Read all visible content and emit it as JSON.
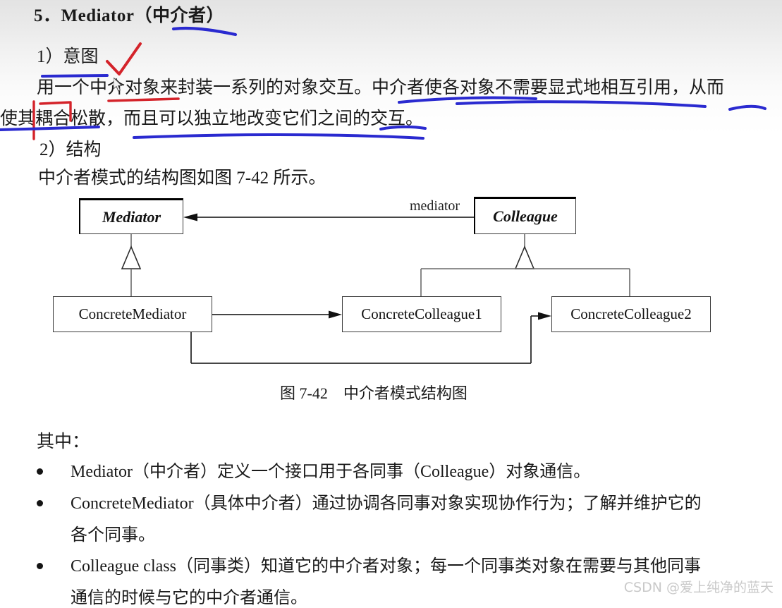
{
  "document": {
    "heading": "5．Mediator（中介者）",
    "section_intent_label": "1）意图",
    "intent_line1": "用一个中介对象来封装一系列的对象交互。中介者使各对象不需要显式地相互引用，从而",
    "intent_line2": "使其耦合松散，而且可以独立地改变它们之间的交互。",
    "section_structure_label": "2）结构",
    "structure_line": "中介者模式的结构图如图 7-42 所示。",
    "figure_caption": "图 7-42　中介者模式结构图",
    "where_label": "其中：",
    "bullets": [
      {
        "line1": "Mediator（中介者）定义一个接口用于各同事（Colleague）对象通信。",
        "line2": ""
      },
      {
        "line1": "ConcreteMediator（具体中介者）通过协调各同事对象实现协作行为；了解并维护它的",
        "line2": "各个同事。"
      },
      {
        "line1": "Colleague class（同事类）知道它的中介者对象；每一个同事类对象在需要与其他同事",
        "line2": "通信的时候与它的中介者通信。"
      }
    ]
  },
  "diagram": {
    "type": "uml-class-diagram",
    "boxes": {
      "mediator": "Mediator",
      "colleague": "Colleague",
      "concrete_mediator": "ConcreteMediator",
      "concrete_colleague1": "ConcreteColleague1",
      "concrete_colleague2": "ConcreteColleague2"
    },
    "association_label": "mediator",
    "relations": [
      "Colleague --mediator--> Mediator (association, arrow to Mediator)",
      "ConcreteMediator --|> Mediator (generalization)",
      "ConcreteColleague1 --|> Colleague (generalization)",
      "ConcreteColleague2 --|> Colleague (generalization)",
      "ConcreteMediator --> ConcreteColleague1 (association)",
      "ConcreteMediator --> ConcreteColleague2 (association)"
    ]
  },
  "annotations": {
    "ink_blue": "#2a2ad0",
    "ink_red": "#d4232a",
    "marks": [
      "blue underline under 中介者 in heading",
      "red check mark after 1）意图",
      "blue underline under 用一个中介",
      "red underline under 介对象来封装一系列",
      "blue underline under 中介者使各对象不需要显式地相互引用",
      "blue underline under 从而",
      "red bracket over 耦合",
      "blue underline under 使其耦合松散",
      "blue underline under 而且可以独立地改变它们之间的交互"
    ]
  },
  "watermark": {
    "text": "CSDN @爱上纯净的蓝天",
    "color": "#c9c9c9"
  }
}
